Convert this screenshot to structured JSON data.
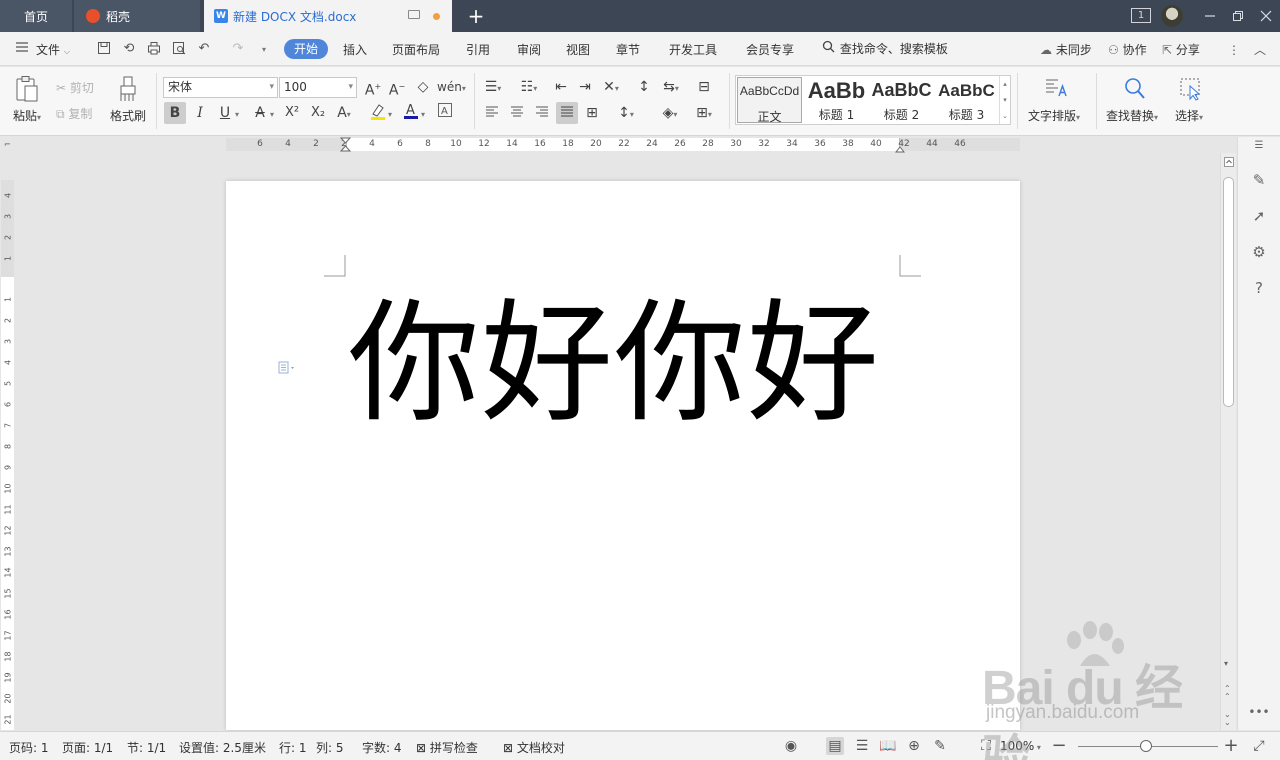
{
  "titlebar": {
    "tabs": [
      {
        "label": "首页"
      },
      {
        "label": "稻壳"
      },
      {
        "label": "新建 DOCX 文档.docx"
      }
    ],
    "new_tab": "+",
    "badge": "1"
  },
  "menubar": {
    "file_label": "文件",
    "items": [
      "开始",
      "插入",
      "页面布局",
      "引用",
      "审阅",
      "视图",
      "章节",
      "开发工具",
      "会员专享"
    ],
    "search_label": "查找命令、搜索模板",
    "sync_label": "未同步",
    "collab_label": "协作",
    "share_label": "分享"
  },
  "ribbon": {
    "paste_label": "粘贴",
    "cut_label": "剪切",
    "copy_label": "复制",
    "format_painter_label": "格式刷",
    "font_name": "宋体",
    "font_size": "100",
    "styles": [
      {
        "preview": "AaBbCcDd",
        "name": "正文"
      },
      {
        "preview": "AaBb",
        "name": "标题 1"
      },
      {
        "preview": "AaBbC",
        "name": "标题 2"
      },
      {
        "preview": "AaBbC",
        "name": "标题 3"
      }
    ],
    "text_layout_label": "文字排版",
    "find_replace_label": "查找替换",
    "select_label": "选择"
  },
  "ruler": {
    "h_ticks": [
      "6",
      "4",
      "2",
      "2",
      "4",
      "6",
      "8",
      "10",
      "12",
      "14",
      "16",
      "18",
      "20",
      "22",
      "24",
      "26",
      "28",
      "30",
      "32",
      "34",
      "36",
      "38",
      "40",
      "42",
      "44",
      "46"
    ],
    "v_ticks": [
      "4",
      "3",
      "2",
      "1",
      "1",
      "2",
      "3",
      "4",
      "5",
      "6",
      "7",
      "8",
      "9",
      "10",
      "11",
      "12",
      "13",
      "14",
      "15",
      "16",
      "17",
      "18",
      "19",
      "20",
      "21"
    ]
  },
  "document": {
    "text": "你好你好"
  },
  "statusbar": {
    "page_num": "页码: 1",
    "pages": "页面: 1/1",
    "section": "节: 1/1",
    "setting": "设置值: 2.5厘米",
    "row": "行: 1",
    "col": "列: 5",
    "word_count": "字数: 4",
    "spell_check": "拼写检查",
    "doc_proof": "文档校对",
    "zoom": "100%"
  },
  "watermark": {
    "site": "jingyan.baidu.com"
  }
}
